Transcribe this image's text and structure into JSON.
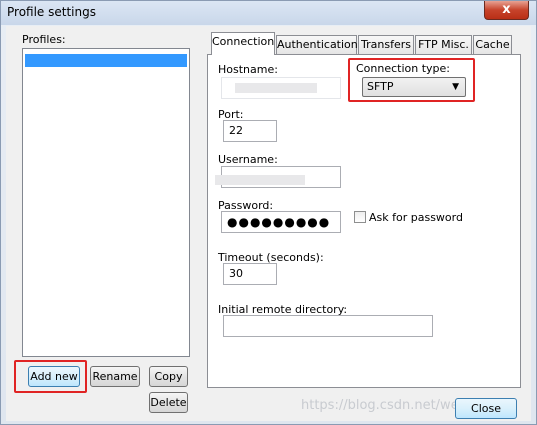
{
  "window": {
    "title": "Profile settings",
    "close_glyph": "x"
  },
  "profiles": {
    "label": "Profiles:",
    "items": [
      ""
    ]
  },
  "buttons": {
    "add_new": "Add new",
    "rename": "Rename",
    "copy": "Copy",
    "delete": "Delete",
    "close": "Close"
  },
  "tabs": [
    {
      "label": "Connection",
      "active": true
    },
    {
      "label": "Authentication",
      "active": false
    },
    {
      "label": "Transfers",
      "active": false
    },
    {
      "label": "FTP Misc.",
      "active": false
    },
    {
      "label": "Cache",
      "active": false
    }
  ],
  "connection": {
    "hostname_label": "Hostname:",
    "hostname_value": "",
    "connection_type_label": "Connection type:",
    "connection_type_value": "SFTP",
    "port_label": "Port:",
    "port_value": "22",
    "username_label": "Username:",
    "username_value": "",
    "password_label": "Password:",
    "password_value": "●●●●●●●●●",
    "ask_for_password_label": "Ask for password",
    "ask_for_password_checked": false,
    "timeout_label": "Timeout (seconds):",
    "timeout_value": "30",
    "initial_dir_label": "Initial remote directory:",
    "initial_dir_value": ""
  },
  "watermark": "https://blog.csdn.net/weixin_4...",
  "colors": {
    "highlight_box": "#e02424",
    "selection": "#3399ff"
  }
}
